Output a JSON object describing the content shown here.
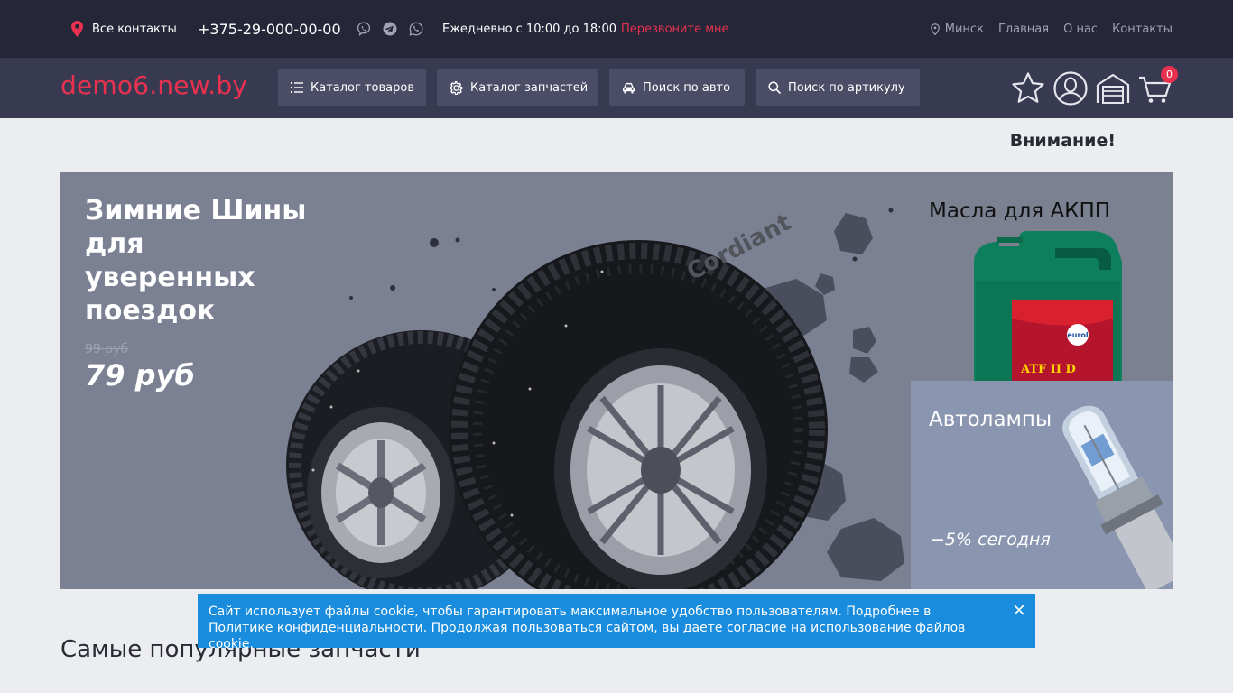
{
  "topbar": {
    "all_contacts": "Все контакты",
    "phone": "+375-29-000-00-00",
    "hours": "Ежедневно с 10:00 до 18:00",
    "callback": "Перезвоните мне",
    "city": "Минск",
    "links": [
      "Главная",
      "О нас",
      "Контакты"
    ]
  },
  "header": {
    "logo": "demo6.new.by",
    "nav": [
      {
        "label": "Каталог товаров",
        "icon": "list-icon"
      },
      {
        "label": "Каталог запчастей",
        "icon": "gear-icon"
      },
      {
        "label": "Поиск по авто",
        "icon": "car-icon"
      },
      {
        "label": "Поиск по артикулу",
        "icon": "search-icon"
      }
    ],
    "cart_count": "0"
  },
  "notice": "Внимание!",
  "hero": {
    "title": "Зимние Шины для уверенных поездок",
    "old_price": "99 руб",
    "price": "79 руб"
  },
  "side_banners": [
    {
      "title": "Масла для АКПП",
      "label_brand": "eurol",
      "label_product": "ATF II D"
    },
    {
      "title": "Автолампы",
      "promo": "−5% сегодня"
    }
  ],
  "section_title": "Самые популярные запчасти",
  "cookie": {
    "text_before": "Сайт использует файлы cookie, чтобы гарантировать максимальное удобство пользователям. Подробнее в ",
    "link": "Политике конфиденциальности",
    "text_after": ". Продолжая пользоваться сайтом, вы даете согласие на использование файлов cookie."
  },
  "colors": {
    "accent": "#e8314f",
    "topbar": "#252638",
    "header": "#383a52",
    "cookie": "#1a8cdd"
  }
}
